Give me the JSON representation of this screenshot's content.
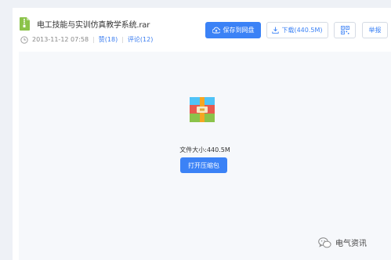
{
  "file": {
    "title": "电工技能与实训仿真教学系统.rar",
    "datetime": "2013-11-12 07:58",
    "likes_label": "赞(18)",
    "comments_label": "评论(12)",
    "size_text": "文件大小:440.5M"
  },
  "actions": {
    "save_label": "保存到网盘",
    "download_label": "下载(440.5M)",
    "report_label": "举报",
    "open_label": "打开压缩包"
  },
  "watermark": {
    "text": "电气资讯"
  },
  "colors": {
    "accent": "#3b82f6",
    "background": "#eef1f6",
    "preview_bg": "#f6f8fb"
  },
  "icons": [
    "zip-file-icon",
    "clock-icon",
    "cloud-save-icon",
    "download-icon",
    "qr-code-icon",
    "archive-icon",
    "wechat-icon"
  ]
}
